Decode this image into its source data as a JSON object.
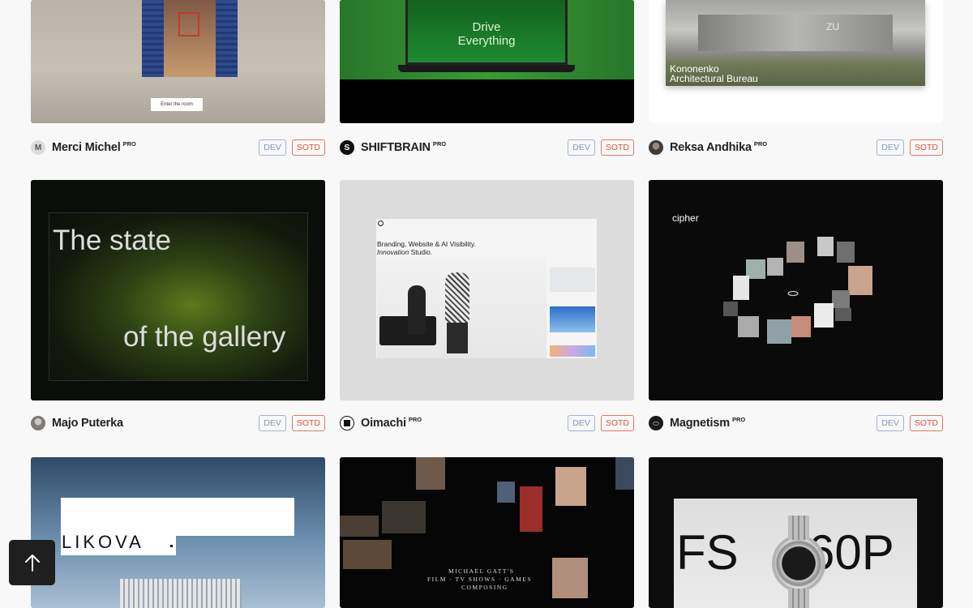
{
  "cards": [
    {
      "author": "Merci Michel",
      "pro": "PRO",
      "avatar_glyph": "M",
      "badges": {
        "dev": "DEV",
        "sotd": "SOTD"
      },
      "preview": {
        "button": "Enter the room"
      }
    },
    {
      "author": "SHIFTBRAIN",
      "pro": "PRO",
      "avatar_glyph": "S",
      "badges": {
        "dev": "DEV",
        "sotd": "SOTD"
      },
      "preview": {
        "headline_1": "Drive",
        "headline_2": "Everything"
      }
    },
    {
      "author": "Reksa Andhika",
      "pro": "PRO",
      "badges": {
        "dev": "DEV",
        "sotd": "SOTD"
      },
      "preview": {
        "title_1": "Kononenko",
        "title_2": "Architectural Bureau",
        "sign": "ZU"
      }
    },
    {
      "author": "Majo Puterka",
      "pro": "",
      "badges": {
        "dev": "DEV",
        "sotd": "SOTD"
      },
      "preview": {
        "line_1": "The state",
        "line_2": "of the gallery"
      }
    },
    {
      "author": "Oimachi",
      "pro": "PRO",
      "badges": {
        "dev": "DEV",
        "sotd": "SOTD"
      },
      "preview": {
        "line_1": "Branding, Website & AI Visibility.",
        "line_2_em": "Innovation",
        "line_2_rest": " Studio."
      }
    },
    {
      "author": "Magnetism",
      "pro": "PRO",
      "badges": {
        "dev": "DEV",
        "sotd": "SOTD"
      },
      "preview": {
        "logo": "cipher"
      }
    },
    {
      "preview": {
        "word": "LIKOVA"
      }
    },
    {
      "preview": {
        "line_1": "MICHAEL GATT'S",
        "line_2": "FILM · TV SHOWS · GAMES",
        "line_3": "COMPOSING"
      }
    },
    {
      "preview": {
        "text_left": "FS",
        "text_right": "60P"
      }
    }
  ],
  "scroll_top": {
    "icon": "arrow-up-icon"
  }
}
